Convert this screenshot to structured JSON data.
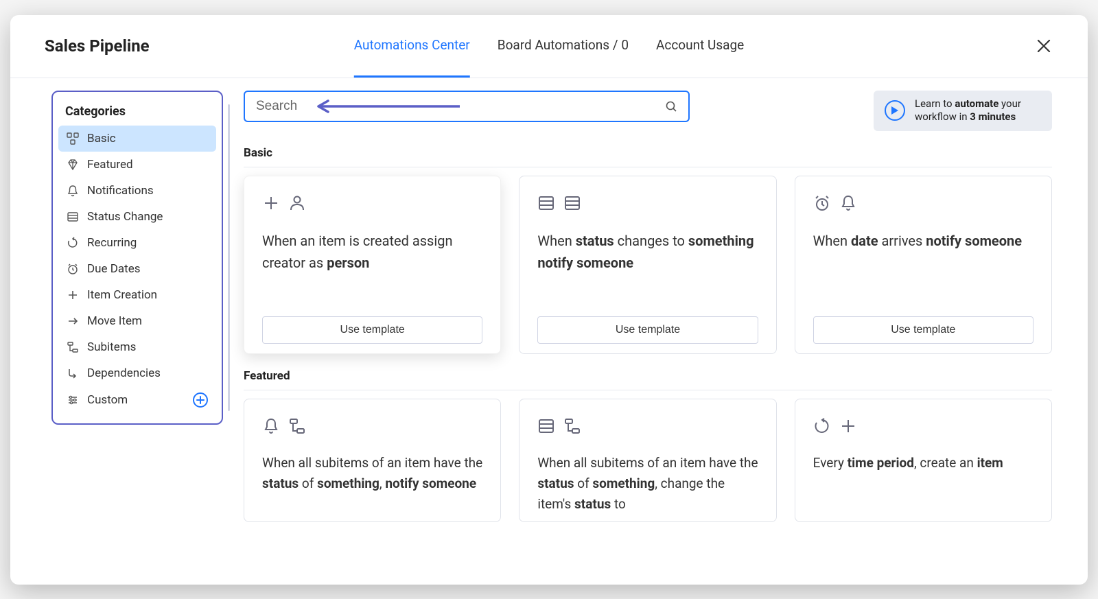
{
  "header": {
    "title": "Sales Pipeline",
    "tabs": [
      {
        "label": "Automations Center",
        "active": true
      },
      {
        "label": "Board Automations / 0",
        "active": false
      },
      {
        "label": "Account Usage",
        "active": false
      }
    ]
  },
  "sidebar": {
    "title": "Categories",
    "items": [
      {
        "label": "Basic",
        "icon": "grid-icon",
        "active": true
      },
      {
        "label": "Featured",
        "icon": "diamond-icon",
        "active": false
      },
      {
        "label": "Notifications",
        "icon": "bell-icon",
        "active": false
      },
      {
        "label": "Status Change",
        "icon": "list-icon",
        "active": false
      },
      {
        "label": "Recurring",
        "icon": "recurring-icon",
        "active": false
      },
      {
        "label": "Due Dates",
        "icon": "alarm-icon",
        "active": false
      },
      {
        "label": "Item Creation",
        "icon": "plus-icon",
        "active": false
      },
      {
        "label": "Move Item",
        "icon": "arrow-right-icon",
        "active": false
      },
      {
        "label": "Subitems",
        "icon": "subitems-icon",
        "active": false
      },
      {
        "label": "Dependencies",
        "icon": "dependencies-icon",
        "active": false
      },
      {
        "label": "Custom",
        "icon": "sliders-icon",
        "active": false,
        "has_add": true
      }
    ]
  },
  "search": {
    "placeholder": "Search"
  },
  "tip": {
    "pre": "Learn to ",
    "bold1": "automate",
    "mid": " your workflow in ",
    "bold2": "3 minutes"
  },
  "sections": {
    "basic": {
      "title": "Basic",
      "use_label": "Use template",
      "cards": [
        {
          "icons": [
            "plus-icon",
            "person-icon"
          ],
          "pre": "When an item is created assign creator as ",
          "b1": "person",
          "mid": "",
          "b2": "",
          "post": ""
        },
        {
          "icons": [
            "list-icon",
            "list-icon"
          ],
          "pre": "When ",
          "b1": "status",
          "mid": " changes to ",
          "b2": "something notify someone",
          "post": ""
        },
        {
          "icons": [
            "alarm-icon",
            "bell-icon"
          ],
          "pre": "When ",
          "b1": "date",
          "mid": " arrives ",
          "b2": "notify someone",
          "post": ""
        }
      ]
    },
    "featured": {
      "title": "Featured",
      "cards": [
        {
          "icons": [
            "bell-icon",
            "subitems-icon"
          ],
          "pre": "When all subitems of an item have the ",
          "b1": "status",
          "mid": " of ",
          "b2": "something",
          "post": ", ",
          "b3": "notify someone"
        },
        {
          "icons": [
            "list-icon",
            "subitems-icon"
          ],
          "pre": "When all subitems of an item have the ",
          "b1": "status",
          "mid": " of ",
          "b2": "something",
          "post": ", change the item's ",
          "b3": "status",
          "post2": " to"
        },
        {
          "icons": [
            "recurring-icon",
            "plus-icon"
          ],
          "pre": "Every ",
          "b1": "time period",
          "mid": ", create an ",
          "b2": "item",
          "post": ""
        }
      ]
    }
  }
}
